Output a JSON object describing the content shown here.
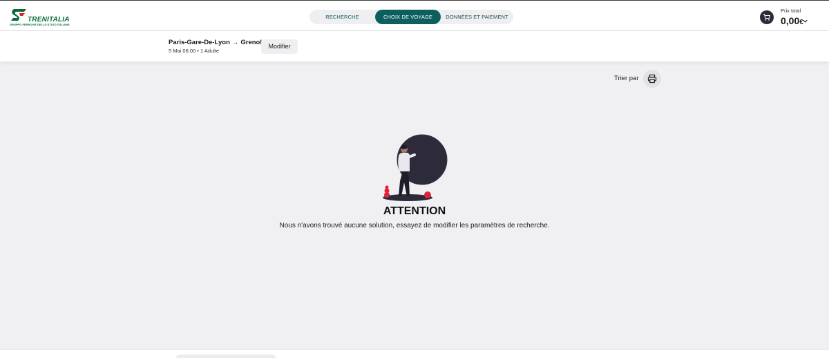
{
  "brand": {
    "name": "TRENITALIA",
    "tagline": "GRUPPO FERROVIE DELLO STATO ITALIANE",
    "color": "#0a6b3a"
  },
  "stepper": {
    "steps": [
      {
        "label": "RECHERCHE",
        "active": false
      },
      {
        "label": "CHOIX DE VOYAGE",
        "active": true
      },
      {
        "label": "DONNÉES ET PAIEMENT",
        "active": false
      }
    ],
    "active_color": "#0d5e5e"
  },
  "cart": {
    "icon": "cart-icon",
    "total_label": "Prix total",
    "total_amount": "0,00",
    "currency": "€"
  },
  "trip": {
    "origin": "Paris-Gare-De-Lyon",
    "arrow": "→",
    "destination": "Grenoble",
    "meta": "5 Mai 06:00 • 1 Adulte",
    "modify_label": "Modifier"
  },
  "toolbar": {
    "sort_label": "Trier par",
    "print_icon": "printer-icon"
  },
  "empty_state": {
    "title": "ATTENTION",
    "message": "Nous n'avons trouvé aucune solution, essayez de modifier les paramètres de recherche.",
    "accent_color": "#e0223a"
  }
}
